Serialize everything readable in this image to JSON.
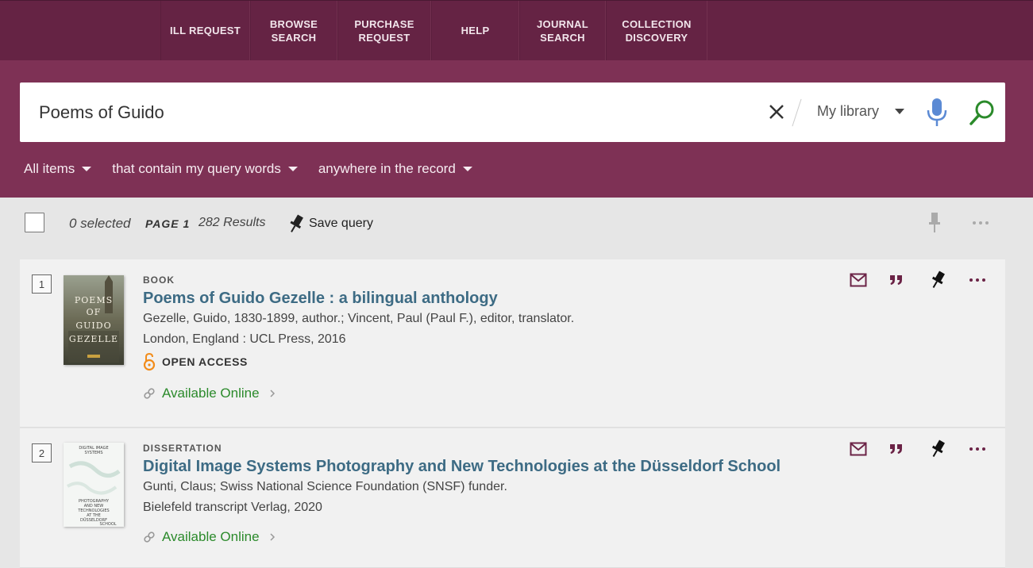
{
  "nav": {
    "items": [
      {
        "label": "ILL REQUEST"
      },
      {
        "label": "BROWSE\nSEARCH"
      },
      {
        "label": "PURCHASE\nREQUEST"
      },
      {
        "label": "HELP"
      },
      {
        "label": "JOURNAL\nSEARCH"
      },
      {
        "label": "COLLECTION\nDISCOVERY"
      }
    ]
  },
  "search": {
    "value": "Poems of Guido",
    "scope": "My library"
  },
  "filters": [
    {
      "label": "All items"
    },
    {
      "label": "that contain my query words"
    },
    {
      "label": "anywhere in the record"
    }
  ],
  "results_bar": {
    "selected": "0 selected",
    "page": "PAGE 1",
    "count": "282 Results",
    "save_query": "Save query"
  },
  "results": [
    {
      "index": "1",
      "type": "BOOK",
      "title": "Poems of Guido Gezelle : a bilingual anthology",
      "authors": "Gezelle, Guido, 1830-1899, author.; Vincent, Paul (Paul F.), editor, translator.",
      "publication": "London, England : UCL Press, 2016",
      "open_access": "OPEN ACCESS",
      "availability": "Available Online",
      "cover_text": [
        "POEMS",
        "OF",
        "GUIDO",
        "GEZELLE"
      ]
    },
    {
      "index": "2",
      "type": "DISSERTATION",
      "title": "Digital Image Systems Photography and New Technologies at the Düsseldorf School",
      "authors": "Gunti, Claus; Swiss National Science Foundation (SNSF) funder.",
      "publication": "Bielefeld transcript Verlag, 2020",
      "availability": "Available Online",
      "cover_text": [
        "DIGITAL IMAGE",
        "SYSTEMS",
        "PHOTOGRAPHY",
        "AND NEW",
        "TECHNOLOGIES",
        "AT THE",
        "DÜSSELDORF",
        "SCHOOL"
      ]
    }
  ],
  "colors": {
    "nav_bg": "#652344",
    "search_bg": "#7e3155",
    "title_link": "#3d6b84",
    "available": "#2b8a2b",
    "action_icon": "#6b2346"
  }
}
